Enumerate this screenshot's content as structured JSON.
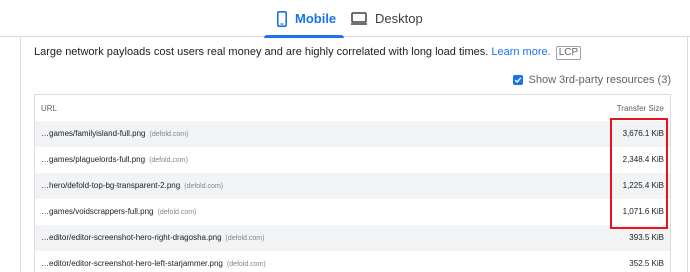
{
  "tabs": {
    "mobile": "Mobile",
    "desktop": "Desktop"
  },
  "description": {
    "text": "Large network payloads cost users real money and are highly correlated with long load times. ",
    "learn_more": "Learn more.",
    "badge": "LCP"
  },
  "third_party": {
    "label": "Show 3rd-party resources (3)",
    "checked": true
  },
  "table": {
    "headers": {
      "url": "URL",
      "size": "Transfer Size"
    },
    "rows": [
      {
        "url": "…games/familyisland-full.png",
        "host": "(defold.com)",
        "size": "3,676.1 KiB"
      },
      {
        "url": "…games/plaguelords-full.png",
        "host": "(defold.com)",
        "size": "2,348.4 KiB"
      },
      {
        "url": "…hero/defold-top-bg-transparent-2.png",
        "host": "(defold.com)",
        "size": "1,225.4 KiB"
      },
      {
        "url": "…games/voidscrappers-full.png",
        "host": "(defold.com)",
        "size": "1,071.6 KiB"
      },
      {
        "url": "…editor/editor-screenshot-hero-right-dragosha.png",
        "host": "(defold.com)",
        "size": "393.5 KiB"
      },
      {
        "url": "…editor/editor-screenshot-hero-left-starjammer.png",
        "host": "(defold.com)",
        "size": "352.5 KiB"
      }
    ]
  },
  "colors": {
    "accent": "#1a73e8",
    "highlight_box": "#e8141b",
    "row_alt": "#f1f3f4"
  },
  "icons": {
    "mobile": "smartphone-icon",
    "desktop": "desktop-monitor-icon",
    "checkbox": "checkbox-checked-icon"
  }
}
